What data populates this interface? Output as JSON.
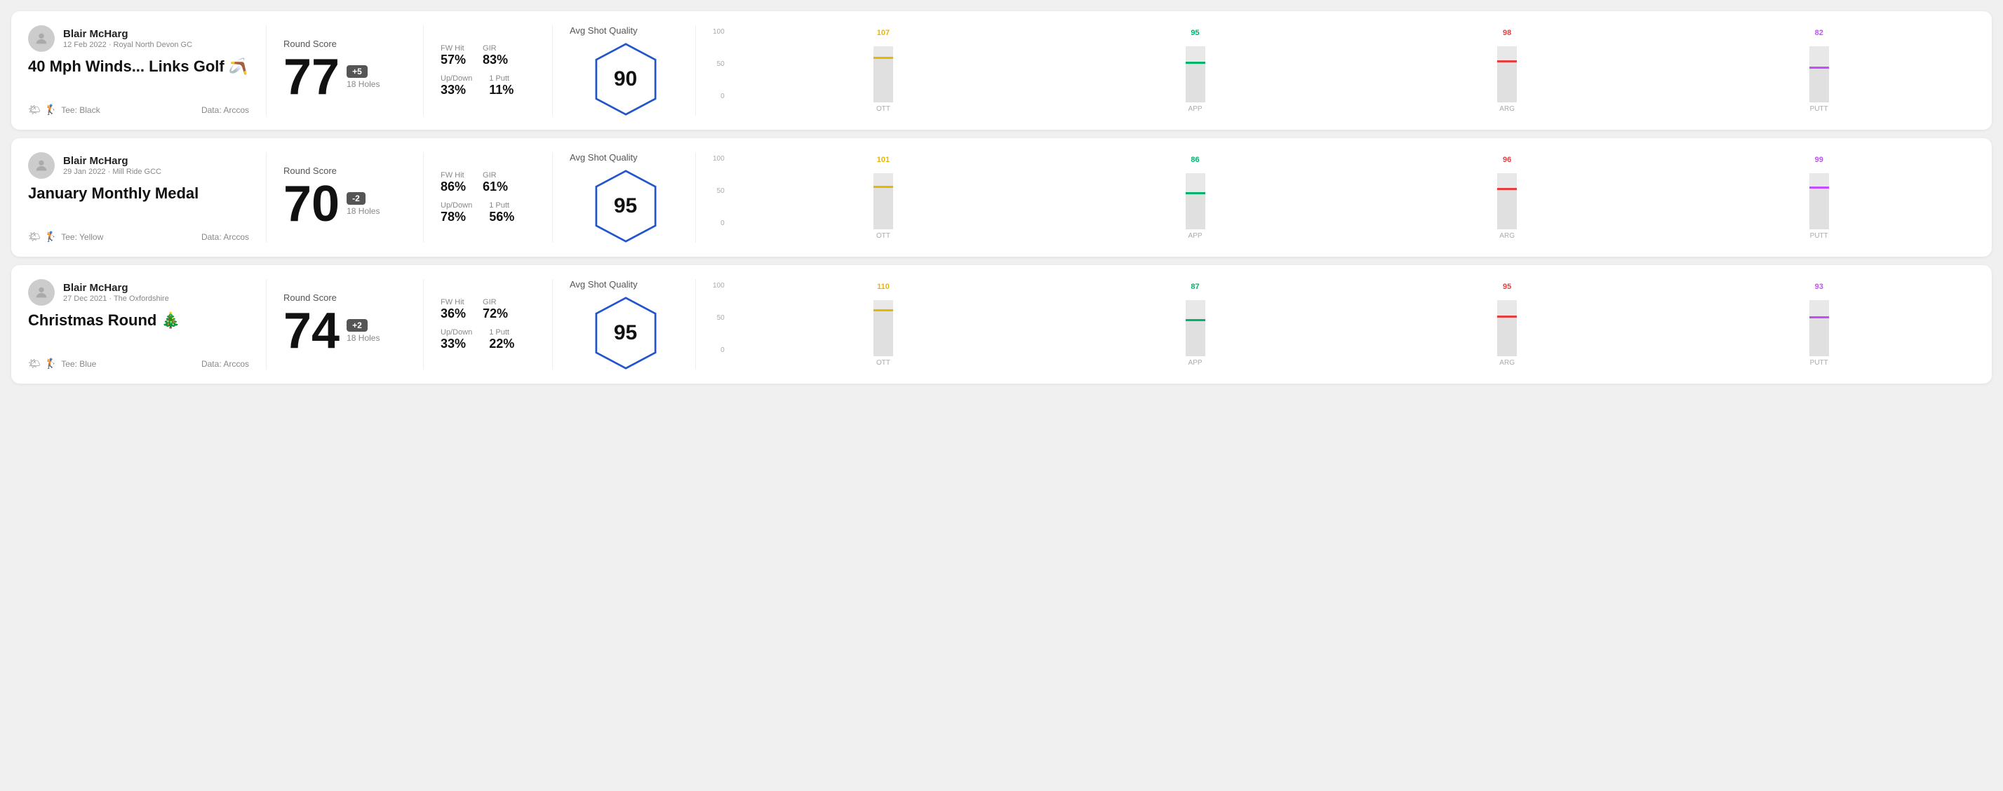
{
  "rounds": [
    {
      "id": "round1",
      "user_name": "Blair McHarg",
      "user_meta": "12 Feb 2022 · Royal North Devon GC",
      "title": "40 Mph Winds... Links Golf 🪃",
      "tee": "Black",
      "data_source": "Data: Arccos",
      "score": "77",
      "score_diff": "+5",
      "holes": "18 Holes",
      "fw_hit_label": "FW Hit",
      "fw_hit_value": "57%",
      "gir_label": "GIR",
      "gir_value": "83%",
      "updown_label": "Up/Down",
      "updown_value": "33%",
      "putt_label": "1 Putt",
      "putt_value": "11%",
      "avg_shot_quality_label": "Avg Shot Quality",
      "hex_score": "90",
      "bars": [
        {
          "label": "OTT",
          "value": 107,
          "color": "#e6b800",
          "pct": 78
        },
        {
          "label": "APP",
          "value": 95,
          "color": "#00b36b",
          "pct": 69
        },
        {
          "label": "ARG",
          "value": 98,
          "color": "#e63e3e",
          "pct": 71
        },
        {
          "label": "PUTT",
          "value": 82,
          "color": "#c44dff",
          "pct": 60
        }
      ],
      "chart_ymax": 100,
      "chart_ymid": 50,
      "chart_ymin": 0
    },
    {
      "id": "round2",
      "user_name": "Blair McHarg",
      "user_meta": "29 Jan 2022 · Mill Ride GCC",
      "title": "January Monthly Medal",
      "tee": "Yellow",
      "data_source": "Data: Arccos",
      "score": "70",
      "score_diff": "-2",
      "holes": "18 Holes",
      "fw_hit_label": "FW Hit",
      "fw_hit_value": "86%",
      "gir_label": "GIR",
      "gir_value": "61%",
      "updown_label": "Up/Down",
      "updown_value": "78%",
      "putt_label": "1 Putt",
      "putt_value": "56%",
      "avg_shot_quality_label": "Avg Shot Quality",
      "hex_score": "95",
      "bars": [
        {
          "label": "OTT",
          "value": 101,
          "color": "#e6b800",
          "pct": 74
        },
        {
          "label": "APP",
          "value": 86,
          "color": "#00b36b",
          "pct": 63
        },
        {
          "label": "ARG",
          "value": 96,
          "color": "#e63e3e",
          "pct": 70
        },
        {
          "label": "PUTT",
          "value": 99,
          "color": "#c44dff",
          "pct": 72
        }
      ],
      "chart_ymax": 100,
      "chart_ymid": 50,
      "chart_ymin": 0
    },
    {
      "id": "round3",
      "user_name": "Blair McHarg",
      "user_meta": "27 Dec 2021 · The Oxfordshire",
      "title": "Christmas Round 🎄",
      "tee": "Blue",
      "data_source": "Data: Arccos",
      "score": "74",
      "score_diff": "+2",
      "holes": "18 Holes",
      "fw_hit_label": "FW Hit",
      "fw_hit_value": "36%",
      "gir_label": "GIR",
      "gir_value": "72%",
      "updown_label": "Up/Down",
      "updown_value": "33%",
      "putt_label": "1 Putt",
      "putt_value": "22%",
      "avg_shot_quality_label": "Avg Shot Quality",
      "hex_score": "95",
      "bars": [
        {
          "label": "OTT",
          "value": 110,
          "color": "#e6b800",
          "pct": 80
        },
        {
          "label": "APP",
          "value": 87,
          "color": "#00b36b",
          "pct": 63
        },
        {
          "label": "ARG",
          "value": 95,
          "color": "#e63e3e",
          "pct": 69
        },
        {
          "label": "PUTT",
          "value": 93,
          "color": "#c44dff",
          "pct": 68
        }
      ],
      "chart_ymax": 100,
      "chart_ymid": 50,
      "chart_ymin": 0
    }
  ]
}
